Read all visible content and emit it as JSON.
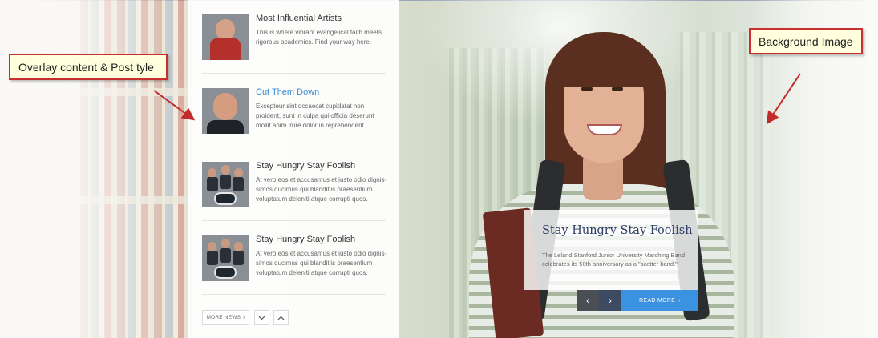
{
  "posts": [
    {
      "title": "Most Influential Artists",
      "excerpt_lines": [
        "This is where vibrant evangelical faith meets",
        "rigorous academics. Find your way here."
      ],
      "thumb_icon": "artist-photo"
    },
    {
      "title": "Cut Them Down",
      "excerpt_lines": [
        "Excepteur sint occaecat cupidatat non",
        "proident, sunt in culpa qui officia deserunt",
        "mollit anim irure dolor in reprehenderit."
      ],
      "thumb_icon": "man-portrait-photo"
    },
    {
      "title": "Stay Hungry Stay Foolish",
      "excerpt_lines": [
        "At vero eos et accusamus et iusto odio dignis-",
        "simos ducimus qui blanditiis praesentium",
        "voluptatum deleniti atque corrupti quos."
      ],
      "thumb_icon": "band-group-photo"
    },
    {
      "title": "Stay Hungry Stay Foolish",
      "excerpt_lines": [
        "At vero eos et accusamus et iusto odio dignis-",
        "simos ducimus qui blanditiis praesentium",
        "voluptatum deleniti atque corrupti quos."
      ],
      "thumb_icon": "band-group-photo"
    }
  ],
  "footer": {
    "more_news_label": "MORE NEWS",
    "more_news_icon": "chevron-right-icon",
    "down_icon": "chevron-down-icon",
    "up_icon": "chevron-up-icon"
  },
  "featured": {
    "title": "Stay Hungry Stay Foolish",
    "excerpt": "The Leland Stanford Junior University Marching Band celebrates its 50th anniversary as a \"scatter band.\"",
    "read_more_label": "READ MORE",
    "prev_icon": "chevron-left-icon",
    "next_icon": "chevron-right-icon"
  },
  "callouts": {
    "overlay": "Overlay content & Post tyle",
    "background": "Background Image"
  },
  "colors": {
    "accent": "#3b92e0",
    "link": "#3a8ad0",
    "callout_border": "#c73030",
    "callout_bg": "#ffffde",
    "featured_title": "#2c3e63"
  }
}
